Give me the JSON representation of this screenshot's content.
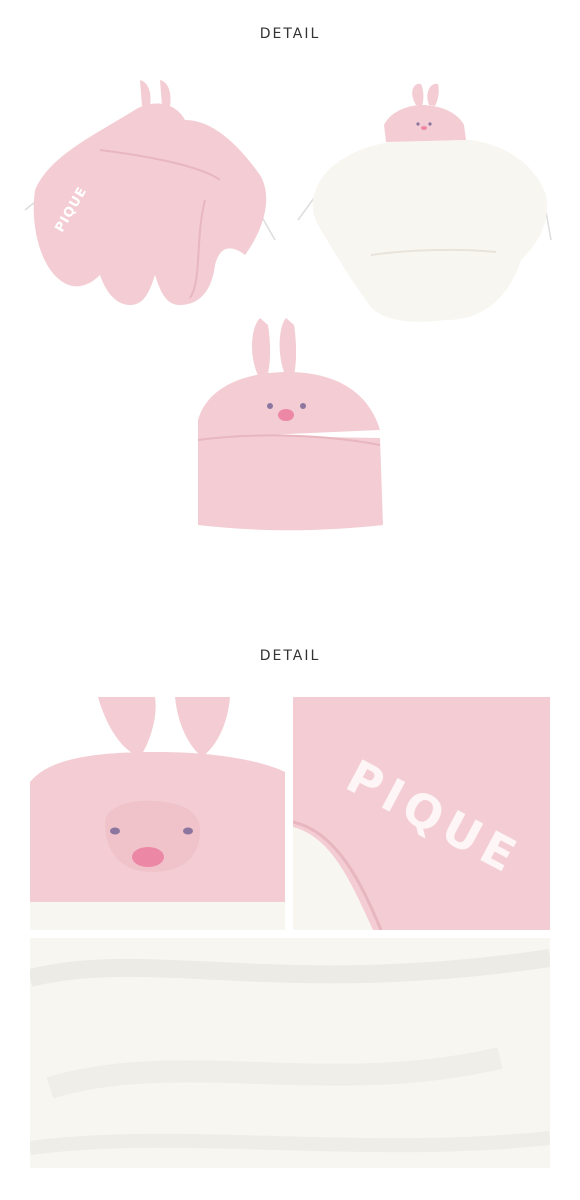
{
  "sections": [
    {
      "heading": "DETAIL"
    },
    {
      "heading": "DETAIL"
    }
  ],
  "brand_text": "PIQUE",
  "colors": {
    "pink": "#f3cdd3",
    "pink_shadow": "#e7b6bf",
    "white_terry": "#f8f6f1",
    "nose": "#ec87a6",
    "eye": "#8c76a0",
    "string": "#dddddd"
  },
  "images": [
    {
      "name": "pink-wrap-front-image",
      "alt": "Pink bunny wrap blanket, back side"
    },
    {
      "name": "white-wrap-inside-image",
      "alt": "Bunny wrap blanket, white inner side"
    },
    {
      "name": "folded-hood-image",
      "alt": "Folded bunny blanket with hood"
    },
    {
      "name": "bunny-face-closeup-image",
      "alt": "Close-up of bunny hood face"
    },
    {
      "name": "logo-closeup-image",
      "alt": "Close-up of PIQUE lettering"
    },
    {
      "name": "white-terry-closeup-image",
      "alt": "Close-up of white terry lining"
    }
  ]
}
